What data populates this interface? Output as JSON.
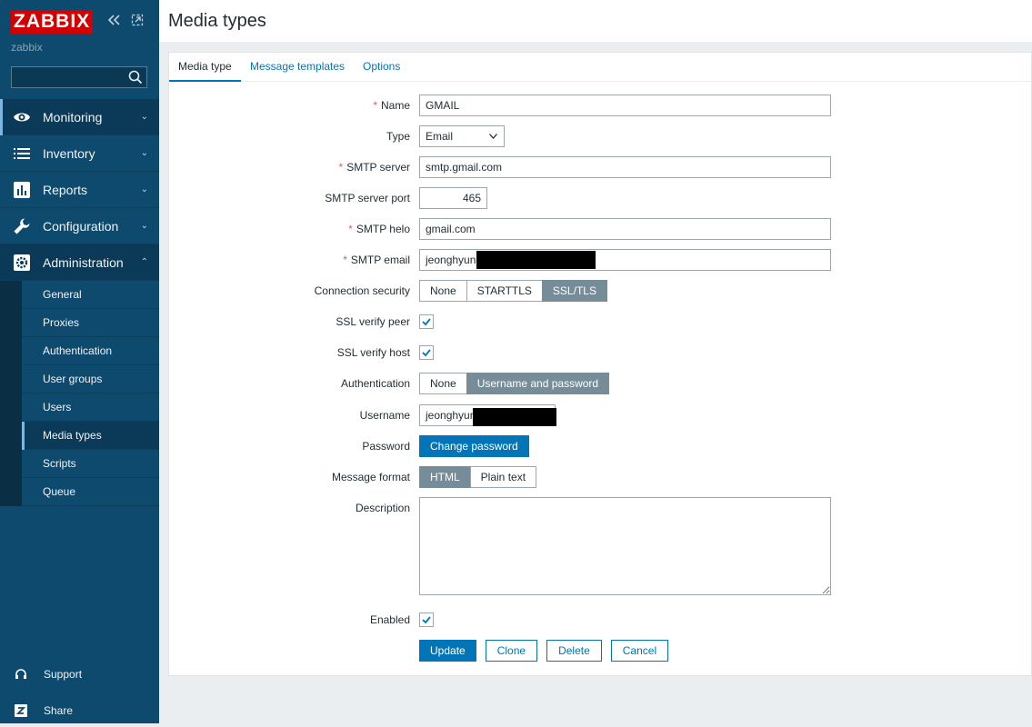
{
  "sidebar": {
    "logo": "ZABBIX",
    "server_name": "zabbix",
    "search_placeholder": "",
    "menu": [
      {
        "label": "Monitoring",
        "icon": "eye-icon"
      },
      {
        "label": "Inventory",
        "icon": "list-icon"
      },
      {
        "label": "Reports",
        "icon": "bar-chart-icon"
      },
      {
        "label": "Configuration",
        "icon": "wrench-icon"
      },
      {
        "label": "Administration",
        "icon": "gear-icon"
      }
    ],
    "admin_submenu": [
      "General",
      "Proxies",
      "Authentication",
      "User groups",
      "Users",
      "Media types",
      "Scripts",
      "Queue"
    ],
    "selected_submenu": "Media types",
    "bottom": [
      {
        "label": "Support",
        "icon": "headset-icon"
      },
      {
        "label": "Share",
        "icon": "share-z-icon"
      }
    ]
  },
  "page": {
    "title": "Media types",
    "tabs": [
      "Media type",
      "Message templates",
      "Options"
    ],
    "active_tab": "Media type"
  },
  "form": {
    "name_label": "Name",
    "name_value": "GMAIL",
    "type_label": "Type",
    "type_value": "Email",
    "smtp_server_label": "SMTP server",
    "smtp_server_value": "smtp.gmail.com",
    "smtp_port_label": "SMTP server port",
    "smtp_port_value": "465",
    "smtp_helo_label": "SMTP helo",
    "smtp_helo_value": "gmail.com",
    "smtp_email_label": "SMTP email",
    "smtp_email_value": "jeonghyun",
    "conn_security_label": "Connection security",
    "conn_security_options": [
      "None",
      "STARTTLS",
      "SSL/TLS"
    ],
    "conn_security_selected": "SSL/TLS",
    "ssl_peer_label": "SSL verify peer",
    "ssl_peer_checked": true,
    "ssl_host_label": "SSL verify host",
    "ssl_host_checked": true,
    "auth_label": "Authentication",
    "auth_options": [
      "None",
      "Username and password"
    ],
    "auth_selected": "Username and password",
    "username_label": "Username",
    "username_value": "jeonghyun",
    "password_label": "Password",
    "change_password_label": "Change password",
    "msg_format_label": "Message format",
    "msg_format_options": [
      "HTML",
      "Plain text"
    ],
    "msg_format_selected": "HTML",
    "description_label": "Description",
    "description_value": "",
    "enabled_label": "Enabled",
    "enabled_checked": true
  },
  "actions": {
    "update": "Update",
    "clone": "Clone",
    "delete": "Delete",
    "cancel": "Cancel"
  },
  "colors": {
    "sidebar_bg": "#0e4a6e",
    "logo_red": "#d40000",
    "accent_blue": "#0275b8",
    "segment_on": "#768d99",
    "required_star": "#e45959"
  }
}
